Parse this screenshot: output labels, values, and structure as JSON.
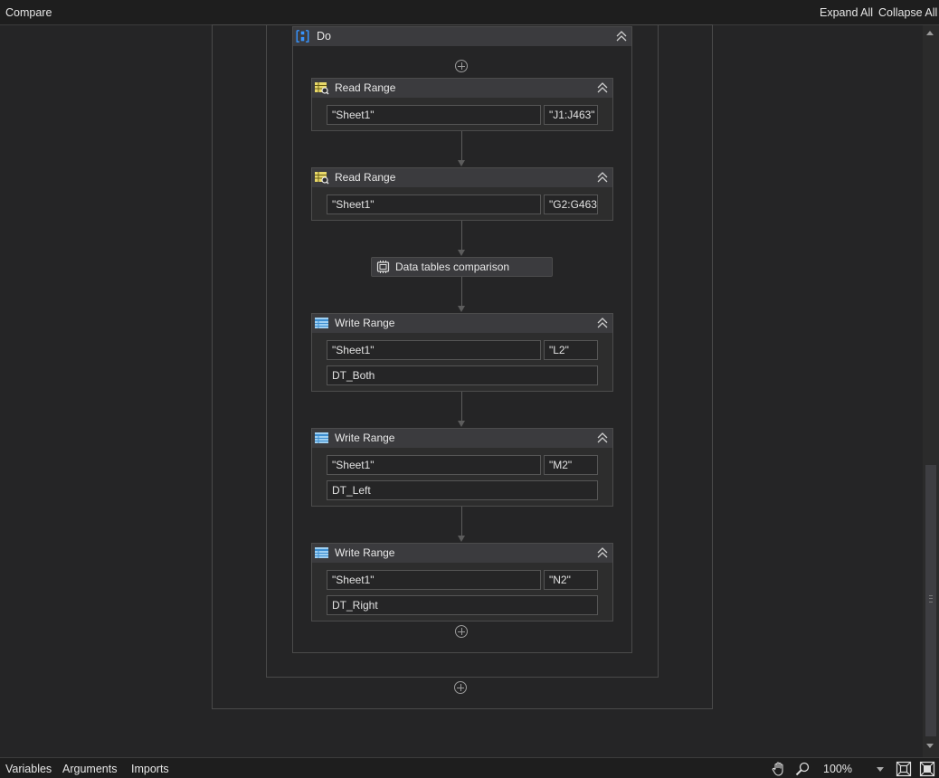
{
  "topbar": {
    "title": "Compare",
    "expand_all": "Expand All",
    "collapse_all": "Collapse All"
  },
  "sequence": {
    "label": "Do"
  },
  "activities": [
    {
      "type": "Read Range",
      "sheet": "\"Sheet1\"",
      "range": "\"J1:J463\""
    },
    {
      "type": "Read Range",
      "sheet": "\"Sheet1\"",
      "range": "\"G2:G463"
    },
    {
      "type": "Write Range",
      "sheet": "\"Sheet1\"",
      "range": "\"L2\"",
      "datatable": "DT_Both"
    },
    {
      "type": "Write Range",
      "sheet": "\"Sheet1\"",
      "range": "\"M2\"",
      "datatable": "DT_Left"
    },
    {
      "type": "Write Range",
      "sheet": "\"Sheet1\"",
      "range": "\"N2\"",
      "datatable": "DT_Right"
    }
  ],
  "comparison": {
    "label": "Data tables comparison"
  },
  "bottombar": {
    "variables": "Variables",
    "arguments": "Arguments",
    "imports": "Imports",
    "zoom": "100%"
  },
  "icons": {
    "read_range": "excel-read-icon",
    "write_range": "excel-write-icon",
    "sequence": "sequence-icon",
    "comparison": "custom-activity-icon",
    "pan": "hand-pan-icon",
    "search": "magnifier-icon",
    "fit": "fit-to-screen-icon",
    "overview": "overview-icon"
  },
  "colors": {
    "background": "#252526",
    "header": "#3b3b3e",
    "accent_blue": "#3794ff",
    "read_icon": "#e8d96a"
  }
}
